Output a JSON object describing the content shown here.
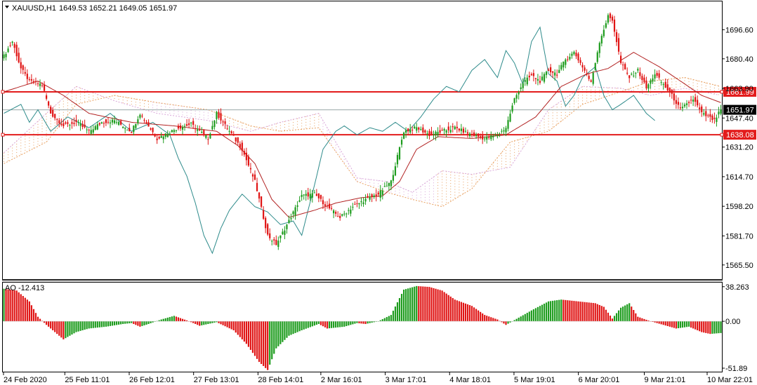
{
  "header": {
    "symbol": "XAUUSD,H1",
    "ohlc": "1649.53 1652.21 1649.05 1651.97"
  },
  "colors": {
    "bull": "#1e9c1e",
    "bear": "#e01414",
    "tenkan": "#b22222",
    "chikou": "#2e8b8b",
    "cloud_up": "#e8a060",
    "cloud_down": "#d9a6d9",
    "level": "#e31c1c",
    "price_line": "#9aa8a8",
    "price_label_bg": "#000000"
  },
  "chart_data": [
    {
      "type": "candlestick",
      "name": "XAUUSD,H1",
      "ylim": [
        1558,
        1712
      ],
      "y_ticks": [
        1696.6,
        1680.4,
        1663.9,
        1647.4,
        1631.2,
        1614.7,
        1598.2,
        1581.7,
        1565.5
      ],
      "y_tick_labels": [
        "1696.60",
        "1680.40",
        "1663.90",
        "1647.40",
        "1631.20",
        "1614.70",
        "1598.20",
        "1581.70",
        "1565.50"
      ],
      "horizontal_levels": [
        {
          "value": 1661.99,
          "label": "1661.99"
        },
        {
          "value": 1638.08,
          "label": "1638.08"
        }
      ],
      "current_price": {
        "value": 1651.97,
        "label": "1651.97"
      },
      "close_path": [
        [
          0,
          1682
        ],
        [
          4,
          1690
        ],
        [
          8,
          1675
        ],
        [
          12,
          1668
        ],
        [
          18,
          1666
        ],
        [
          22,
          1650
        ],
        [
          28,
          1643
        ],
        [
          34,
          1645
        ],
        [
          40,
          1640
        ],
        [
          46,
          1645
        ],
        [
          52,
          1646
        ],
        [
          60,
          1640
        ],
        [
          64,
          1650
        ],
        [
          72,
          1636
        ],
        [
          82,
          1642
        ],
        [
          88,
          1644
        ],
        [
          96,
          1636
        ],
        [
          100,
          1650
        ],
        [
          106,
          1640
        ],
        [
          112,
          1630
        ],
        [
          118,
          1612
        ],
        [
          124,
          1582
        ],
        [
          128,
          1577
        ],
        [
          134,
          1590
        ],
        [
          140,
          1604
        ],
        [
          146,
          1605
        ],
        [
          152,
          1598
        ],
        [
          158,
          1592
        ],
        [
          164,
          1598
        ],
        [
          170,
          1602
        ],
        [
          176,
          1605
        ],
        [
          182,
          1612
        ],
        [
          188,
          1640
        ],
        [
          194,
          1642
        ],
        [
          200,
          1638
        ],
        [
          206,
          1640
        ],
        [
          212,
          1642
        ],
        [
          220,
          1638
        ],
        [
          226,
          1636
        ],
        [
          232,
          1638
        ],
        [
          236,
          1642
        ],
        [
          240,
          1658
        ],
        [
          244,
          1667
        ],
        [
          248,
          1671
        ],
        [
          252,
          1668
        ],
        [
          256,
          1674
        ],
        [
          260,
          1672
        ],
        [
          264,
          1680
        ],
        [
          268,
          1684
        ],
        [
          272,
          1676
        ],
        [
          276,
          1667
        ],
        [
          280,
          1690
        ],
        [
          284,
          1704
        ],
        [
          286,
          1702
        ],
        [
          290,
          1678
        ],
        [
          294,
          1670
        ],
        [
          298,
          1674
        ],
        [
          302,
          1664
        ],
        [
          306,
          1672
        ],
        [
          310,
          1666
        ],
        [
          314,
          1660
        ],
        [
          318,
          1652
        ],
        [
          324,
          1658
        ],
        [
          328,
          1650
        ],
        [
          334,
          1646
        ],
        [
          337,
          1652
        ]
      ],
      "tenkan_path": [
        [
          0,
          1662
        ],
        [
          16,
          1668
        ],
        [
          28,
          1660
        ],
        [
          40,
          1650
        ],
        [
          60,
          1645
        ],
        [
          80,
          1643
        ],
        [
          100,
          1640
        ],
        [
          110,
          1632
        ],
        [
          118,
          1622
        ],
        [
          126,
          1602
        ],
        [
          134,
          1592
        ],
        [
          146,
          1596
        ],
        [
          156,
          1600
        ],
        [
          168,
          1603
        ],
        [
          178,
          1604
        ],
        [
          186,
          1612
        ],
        [
          194,
          1630
        ],
        [
          204,
          1637
        ],
        [
          220,
          1636
        ],
        [
          236,
          1638
        ],
        [
          250,
          1648
        ],
        [
          262,
          1665
        ],
        [
          274,
          1672
        ],
        [
          284,
          1675
        ],
        [
          296,
          1684
        ],
        [
          308,
          1676
        ],
        [
          318,
          1668
        ],
        [
          328,
          1660
        ],
        [
          337,
          1656
        ]
      ],
      "chikou_path": [
        [
          0,
          1650
        ],
        [
          8,
          1655
        ],
        [
          12,
          1645
        ],
        [
          16,
          1652
        ],
        [
          22,
          1640
        ],
        [
          30,
          1648
        ],
        [
          40,
          1642
        ],
        [
          50,
          1650
        ],
        [
          60,
          1640
        ],
        [
          70,
          1645
        ],
        [
          78,
          1638
        ],
        [
          82,
          1625
        ],
        [
          86,
          1615
        ],
        [
          90,
          1600
        ],
        [
          94,
          1582
        ],
        [
          98,
          1572
        ],
        [
          102,
          1586
        ],
        [
          106,
          1596
        ],
        [
          112,
          1605
        ],
        [
          118,
          1598
        ],
        [
          124,
          1595
        ],
        [
          130,
          1588
        ],
        [
          136,
          1590
        ],
        [
          140,
          1582
        ],
        [
          146,
          1610
        ],
        [
          150,
          1630
        ],
        [
          156,
          1640
        ],
        [
          160,
          1643
        ],
        [
          166,
          1638
        ],
        [
          172,
          1642
        ],
        [
          178,
          1640
        ],
        [
          184,
          1645
        ],
        [
          190,
          1640
        ],
        [
          196,
          1648
        ],
        [
          202,
          1658
        ],
        [
          208,
          1665
        ],
        [
          214,
          1662
        ],
        [
          220,
          1674
        ],
        [
          226,
          1680
        ],
        [
          232,
          1670
        ],
        [
          236,
          1685
        ],
        [
          240,
          1678
        ],
        [
          244,
          1666
        ],
        [
          248,
          1690
        ],
        [
          252,
          1698
        ],
        [
          256,
          1672
        ],
        [
          260,
          1668
        ],
        [
          264,
          1654
        ],
        [
          268,
          1660
        ],
        [
          272,
          1670
        ],
        [
          278,
          1676
        ],
        [
          282,
          1660
        ],
        [
          286,
          1652
        ],
        [
          290,
          1655
        ],
        [
          296,
          1660
        ],
        [
          302,
          1650
        ],
        [
          306,
          1646
        ]
      ],
      "cloud_path_a": [
        [
          0,
          1622
        ],
        [
          20,
          1634
        ],
        [
          34,
          1655
        ],
        [
          52,
          1660
        ],
        [
          72,
          1656
        ],
        [
          96,
          1652
        ],
        [
          116,
          1643
        ],
        [
          130,
          1640
        ],
        [
          148,
          1642
        ],
        [
          166,
          1612
        ],
        [
          180,
          1606
        ],
        [
          192,
          1602
        ],
        [
          206,
          1598
        ],
        [
          220,
          1608
        ],
        [
          238,
          1634
        ],
        [
          256,
          1640
        ],
        [
          272,
          1655
        ],
        [
          290,
          1662
        ],
        [
          304,
          1668
        ],
        [
          320,
          1670
        ],
        [
          337,
          1665
        ]
      ],
      "cloud_path_b": [
        [
          0,
          1628
        ],
        [
          20,
          1650
        ],
        [
          34,
          1665
        ],
        [
          52,
          1657
        ],
        [
          72,
          1650
        ],
        [
          96,
          1646
        ],
        [
          116,
          1640
        ],
        [
          130,
          1645
        ],
        [
          148,
          1650
        ],
        [
          166,
          1614
        ],
        [
          180,
          1612
        ],
        [
          192,
          1606
        ],
        [
          206,
          1618
        ],
        [
          220,
          1616
        ],
        [
          238,
          1620
        ],
        [
          256,
          1652
        ],
        [
          272,
          1665
        ],
        [
          290,
          1664
        ],
        [
          304,
          1660
        ],
        [
          320,
          1664
        ],
        [
          337,
          1660
        ]
      ],
      "cloud_color_switch": [
        [
          0,
          "up"
        ],
        [
          70,
          "down"
        ],
        [
          102,
          "up"
        ],
        [
          150,
          "down"
        ],
        [
          204,
          "up"
        ]
      ]
    },
    {
      "type": "bar",
      "name": "AO",
      "label": "AO -12.413",
      "ylim": [
        -55,
        42
      ],
      "y_ticks": [
        38.263,
        0.0,
        -51.89
      ],
      "y_tick_labels": [
        "38.263",
        "0.00",
        "-51.89"
      ],
      "values_path": [
        [
          0,
          36
        ],
        [
          6,
          34
        ],
        [
          12,
          22
        ],
        [
          16,
          5
        ],
        [
          20,
          -4
        ],
        [
          28,
          -20
        ],
        [
          34,
          -12
        ],
        [
          40,
          -8
        ],
        [
          48,
          -6
        ],
        [
          56,
          -3
        ],
        [
          60,
          -2
        ],
        [
          64,
          -6
        ],
        [
          68,
          -3
        ],
        [
          74,
          2
        ],
        [
          80,
          6
        ],
        [
          86,
          1
        ],
        [
          92,
          -5
        ],
        [
          100,
          -1
        ],
        [
          108,
          -10
        ],
        [
          114,
          -25
        ],
        [
          120,
          -45
        ],
        [
          124,
          -54
        ],
        [
          128,
          -30
        ],
        [
          134,
          -16
        ],
        [
          140,
          -10
        ],
        [
          148,
          -3
        ],
        [
          152,
          -8
        ],
        [
          160,
          -6
        ],
        [
          166,
          -2
        ],
        [
          170,
          -3
        ],
        [
          176,
          0
        ],
        [
          182,
          7
        ],
        [
          188,
          35
        ],
        [
          194,
          39
        ],
        [
          200,
          38
        ],
        [
          206,
          34
        ],
        [
          212,
          24
        ],
        [
          220,
          17
        ],
        [
          226,
          7
        ],
        [
          232,
          2
        ],
        [
          236,
          -4
        ],
        [
          242,
          4
        ],
        [
          248,
          12
        ],
        [
          256,
          22
        ],
        [
          262,
          24
        ],
        [
          270,
          22
        ],
        [
          278,
          20
        ],
        [
          282,
          16
        ],
        [
          286,
          3
        ],
        [
          290,
          15
        ],
        [
          294,
          20
        ],
        [
          298,
          5
        ],
        [
          304,
          0
        ],
        [
          310,
          -4
        ],
        [
          316,
          -8
        ],
        [
          322,
          -6
        ],
        [
          328,
          -12
        ],
        [
          332,
          -14
        ],
        [
          337,
          -13
        ]
      ],
      "value_label": "-12.413"
    }
  ],
  "x_axis": {
    "type": "date",
    "bars_total": 338,
    "tick_labels": [
      {
        "bar": 0,
        "label": "24 Feb 2020"
      },
      {
        "bar": 40,
        "label": "25 Feb 11:01"
      },
      {
        "bar": 82,
        "label": "26 Feb 12:01"
      },
      {
        "bar": 124,
        "label": "27 Feb 13:01"
      },
      {
        "bar": 166,
        "label": "28 Feb 14:01"
      },
      {
        "bar": 207,
        "label": "2 Mar 16:01"
      },
      {
        "bar": 249,
        "label": "3 Mar 17:01"
      },
      {
        "bar": 291,
        "label": "4 Mar 18:01"
      },
      {
        "bar": 333,
        "label": "5 Mar 19:01"
      },
      {
        "bar": 375,
        "label": "6 Mar 20:01"
      },
      {
        "bar": 418,
        "label": "9 Mar 21:01"
      },
      {
        "bar": 459,
        "label": "10 Mar 22:01"
      }
    ]
  }
}
